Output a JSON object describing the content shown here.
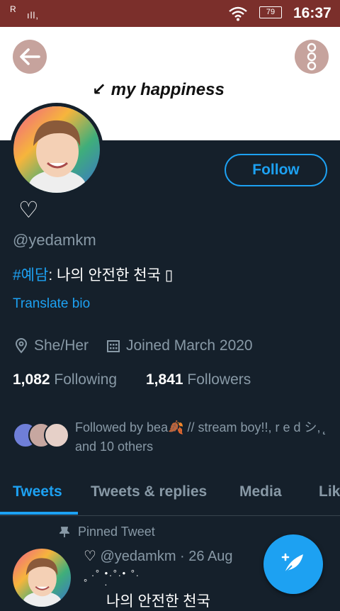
{
  "status_bar": {
    "carrier": "R",
    "signal": "ıll,",
    "battery": "79",
    "time": "16:37"
  },
  "banner": {
    "text": "↙ my happiness"
  },
  "profile": {
    "name_icon": "heart-outline-icon",
    "name": "♡",
    "handle": "@yedamkm",
    "bio_tag": "#예담",
    "bio_rest": ": 나의 안전한 천국 ▯",
    "translate": "Translate bio",
    "pronouns": "She/Her",
    "joined": "Joined March 2020",
    "following_count": "1,082",
    "following_label": "Following",
    "followers_count": "1,841",
    "followers_label": "Followers",
    "followed_by": "Followed by bea🍂 // stream boy!!, r e d シ, ̨̨ and 10 others"
  },
  "actions": {
    "follow": "Follow"
  },
  "tabs": [
    "Tweets",
    "Tweets & replies",
    "Media",
    "Likes"
  ],
  "pinned_tweet": {
    "pinned_label": "Pinned Tweet",
    "name": "♡",
    "handle_date": "@yedamkm · 26 Aug",
    "decoration": "  .° •.°.• °.\n°    .",
    "text": "나의 안전한 천국"
  },
  "colors": {
    "background": "#15202b",
    "accent": "#1da1f2",
    "status_bar": "#7b2f2b",
    "muted": "#8899a6"
  }
}
